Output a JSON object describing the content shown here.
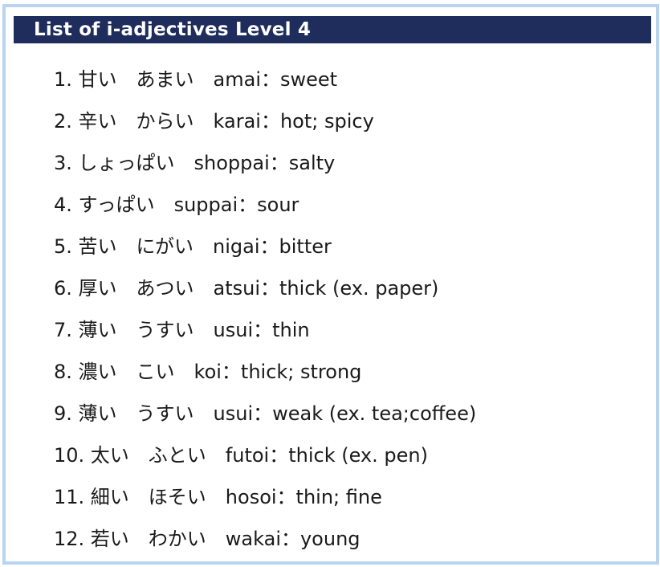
{
  "title": "List of i-adjectives Level 4",
  "items": [
    "1. 甘い　あまい　amai：sweet",
    "2. 辛い　からい　karai：hot; spicy",
    "3. しょっぱい　shoppai：salty",
    "4. すっぱい　suppai：sour",
    "5. 苦い　にがい　nigai：bitter",
    "6. 厚い　あつい　atsui：thick (ex. paper)",
    "7. 薄い　うすい　usui：thin",
    "8. 濃い　こい　koi：thick; strong",
    "9. 薄い　うすい　usui：weak (ex. tea;coffee)",
    "10. 太い　ふとい　futoi：thick (ex. pen)",
    "11. 細い　ほそい　hosoi：thin; fine",
    "12. 若い　わかい　wakai：young"
  ]
}
